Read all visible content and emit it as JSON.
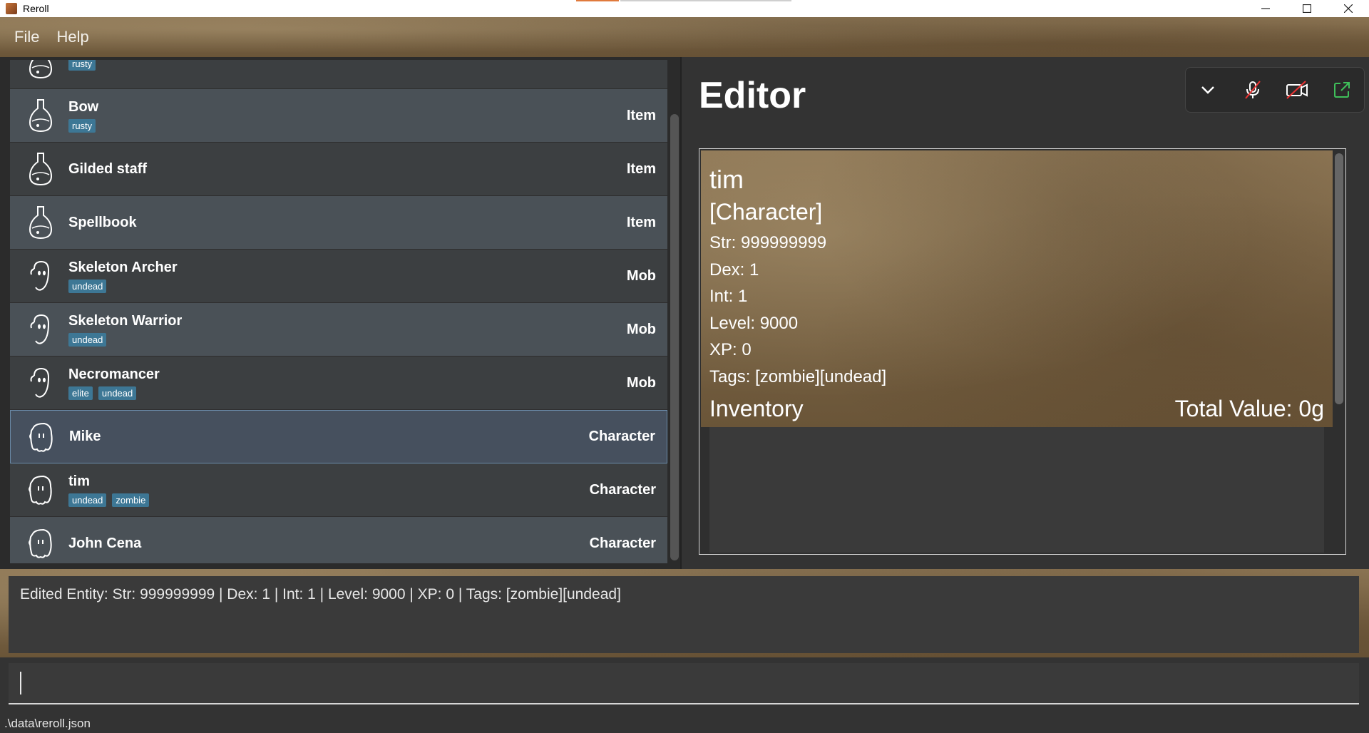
{
  "window": {
    "title": "Reroll"
  },
  "menu": {
    "file": "File",
    "help": "Help"
  },
  "list": {
    "items": [
      {
        "name": "",
        "type": "",
        "tags": [
          "rusty"
        ],
        "icon": "potion-icon"
      },
      {
        "name": "Bow",
        "type": "Item",
        "tags": [
          "rusty"
        ],
        "icon": "potion-icon"
      },
      {
        "name": "Gilded staff",
        "type": "Item",
        "tags": [],
        "icon": "potion-icon"
      },
      {
        "name": "Spellbook",
        "type": "Item",
        "tags": [],
        "icon": "potion-icon"
      },
      {
        "name": "Skeleton Archer",
        "type": "Mob",
        "tags": [
          "undead"
        ],
        "icon": "ghost-icon"
      },
      {
        "name": "Skeleton Warrior",
        "type": "Mob",
        "tags": [
          "undead"
        ],
        "icon": "ghost-icon"
      },
      {
        "name": "Necromancer",
        "type": "Mob",
        "tags": [
          "elite",
          "undead"
        ],
        "icon": "ghost-icon"
      },
      {
        "name": "Mike",
        "type": "Character",
        "tags": [],
        "icon": "character-icon",
        "selected": true
      },
      {
        "name": "tim",
        "type": "Character",
        "tags": [
          "undead",
          "zombie"
        ],
        "icon": "character-icon"
      },
      {
        "name": "John Cena",
        "type": "Character",
        "tags": [],
        "icon": "character-icon"
      }
    ]
  },
  "editor": {
    "title": "Editor",
    "card": {
      "name": "tim",
      "type": "[Character]",
      "str": "Str: 999999999",
      "dex": "Dex: 1",
      "int": "Int: 1",
      "level": "Level: 9000",
      "xp": "XP: 0",
      "tags": "Tags: [zombie][undead]",
      "inventory_label": "Inventory",
      "total_value": "Total Value: 0g"
    }
  },
  "result": {
    "text": "Edited Entity: Str: 999999999 | Dex: 1 | Int: 1 | Level: 9000 | XP: 0 | Tags: [zombie][undead]"
  },
  "command": {
    "value": "",
    "placeholder": ""
  },
  "status": {
    "path": ".\\data\\reroll.json"
  },
  "colors": {
    "tag_bg": "#3d7795",
    "row_alt": "#4a5157",
    "row_norm": "#3c3f41",
    "selected_border": "#6a8aa8"
  }
}
